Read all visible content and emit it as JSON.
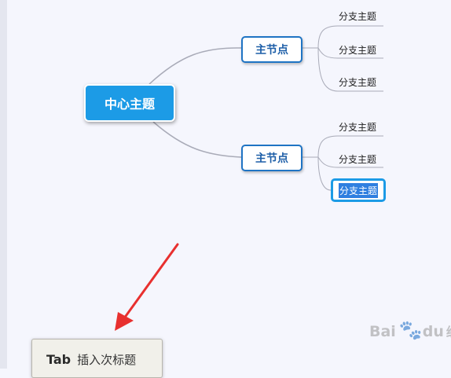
{
  "mindmap": {
    "center": "中心主题",
    "main_top": "主节点",
    "main_bottom": "主节点",
    "leaves_top": [
      "分支主题",
      "分支主题",
      "分支主题"
    ],
    "leaves_bottom": [
      "分支主题",
      "分支主题"
    ],
    "selected_leaf": "分支主题"
  },
  "tooltip": {
    "key": "Tab",
    "text": "插入次标题"
  },
  "watermark": {
    "brand": "Bai",
    "brand_tail": "du",
    "cn": "经验"
  },
  "colors": {
    "center_fill": "#1c9be6",
    "main_border": "#1f74c4",
    "selection": "#1c9be6",
    "arrow": "#e8302f",
    "connector": "#a9abb8"
  }
}
